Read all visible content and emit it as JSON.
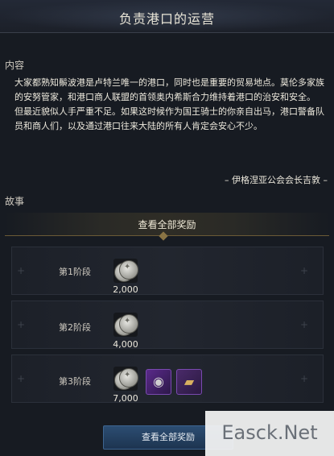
{
  "quest": {
    "title": "负责港口的运营",
    "content_label": "内容",
    "description": [
      "大家都熟知鬃波港是卢特兰唯一的港口，同时也是重要的贸易地点。莫伦多家族的安努管家，和港口商人联盟的首领奥内希斯合力维持着港口的治安和安全。",
      "但最近貌似人手严重不足。如果这时候作为国王骑士的你亲自出马，港口警备队员和商人们，以及通过港口往来大陆的所有人肯定会安心不少。"
    ],
    "signature": "– 伊格涅亚公会会长吉敦 –",
    "story_label": "故事"
  },
  "rewards": {
    "header": "查看全部奖励",
    "stages": [
      {
        "label": "第1阶段",
        "amount": "2,000"
      },
      {
        "label": "第2阶段",
        "amount": "4,000"
      },
      {
        "label": "第3阶段",
        "amount": "7,000"
      }
    ],
    "bottom_button": "查看全部奖励"
  },
  "watermark": "Easck.Net"
}
